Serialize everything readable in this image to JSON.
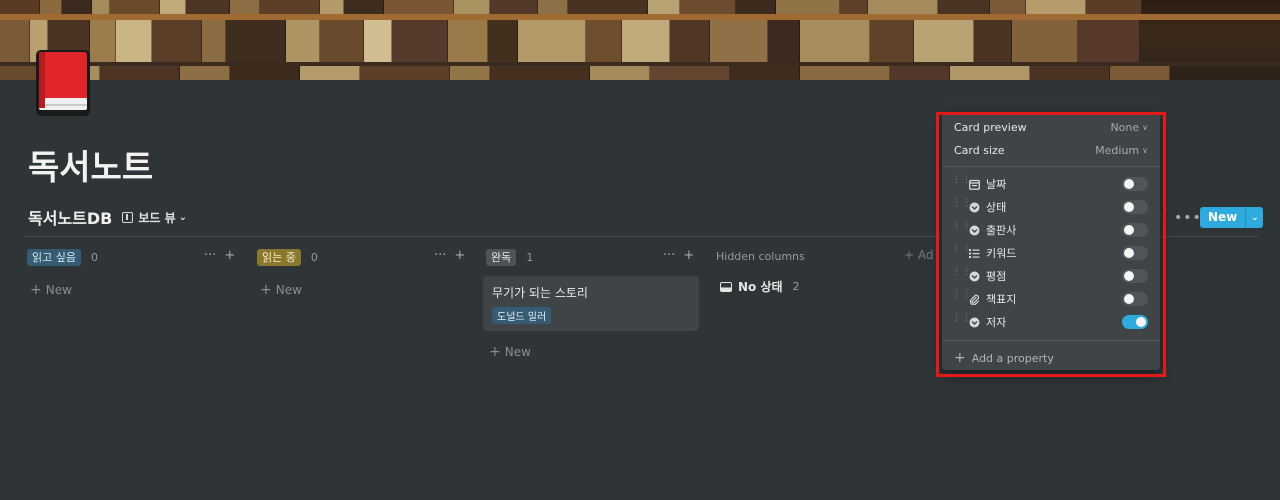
{
  "page": {
    "title": "독서노트",
    "icon": "red-book-icon"
  },
  "database": {
    "title": "독서노트DB",
    "view_label": "보드 뷰",
    "new_button": "New"
  },
  "board": {
    "columns": [
      {
        "tag": "읽고 싶음",
        "tag_color": "#365c74",
        "count": "0",
        "add_label": "New"
      },
      {
        "tag": "읽는 중",
        "tag_color": "#89782e",
        "count": "0",
        "add_label": "New"
      },
      {
        "tag": "완독",
        "tag_color": "#4f5356",
        "count": "1",
        "add_label": "New"
      }
    ],
    "card": {
      "title": "무기가 되는 스토리",
      "tag": "도널드 밀러"
    },
    "hidden": {
      "label": "Hidden columns",
      "add_label": "Ad",
      "group": "No 상태",
      "count": "2"
    }
  },
  "popup": {
    "card_preview_label": "Card preview",
    "card_preview_value": "None",
    "card_size_label": "Card size",
    "card_size_value": "Medium",
    "properties": [
      {
        "label": "날짜",
        "icon": "calendar-icon",
        "visible": false
      },
      {
        "label": "상태",
        "icon": "select-icon",
        "visible": false
      },
      {
        "label": "출판사",
        "icon": "select-icon",
        "visible": false
      },
      {
        "label": "키워드",
        "icon": "list-icon",
        "visible": false
      },
      {
        "label": "평점",
        "icon": "select-icon",
        "visible": false
      },
      {
        "label": "책표지",
        "icon": "paperclip-icon",
        "visible": false
      },
      {
        "label": "저자",
        "icon": "select-icon",
        "visible": true
      }
    ],
    "add_property_label": "Add a property"
  },
  "colors": {
    "background": "#2f3437",
    "accent": "#2eaadc",
    "highlight": "#e21a1a"
  }
}
